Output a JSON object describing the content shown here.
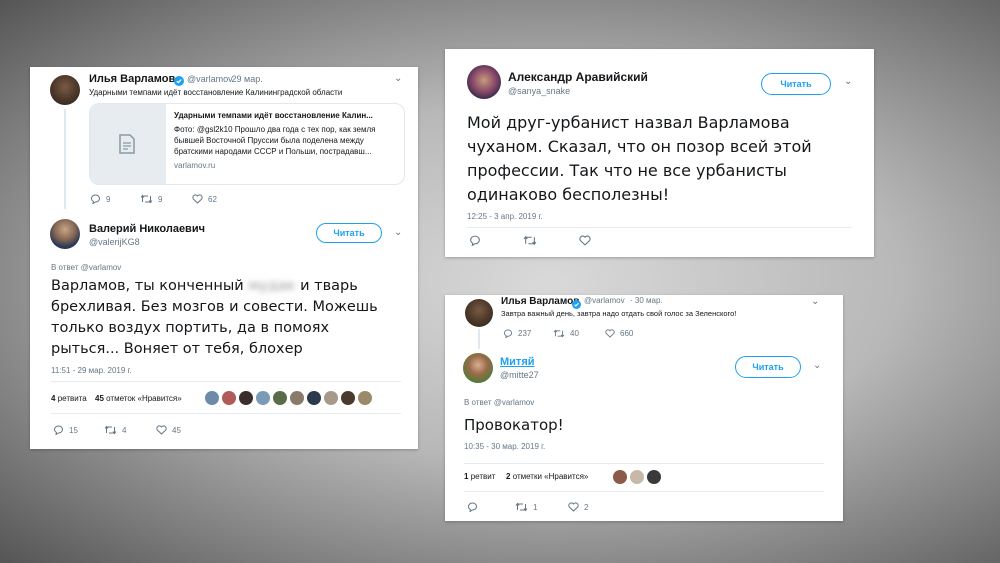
{
  "card1": {
    "author": "Илья Варламов",
    "handle": "@varlamov",
    "date": "· 29 мар.",
    "text": "Ударными темпами идёт восстановление Калининградской области",
    "link_title": "Ударными темпами идёт восстановление Калин...",
    "link_desc_1": "Фото: @gsl2k10 Прошло два года с тех пор, как земля",
    "link_desc_2": "бывшей Восточной Пруссии была поделена между",
    "link_desc_3": "братскими народами СССР и Польши, пострадавш...",
    "link_domain": "varlamov.ru",
    "replies": "9",
    "retweets": "9",
    "likes": "62",
    "reply_author": "Валерий Николаевич",
    "reply_handle": "@valerijKG8",
    "follow": "Читать",
    "in_reply_to": "В ответ @varlamov",
    "reply_line_1a": "Варламов, ты конченный",
    "reply_blurred": "мудак",
    "reply_line_1b": "и тварь",
    "reply_line_2": "брехливая. Без мозгов и совести. Можешь",
    "reply_line_3": "только воздух портить, да в помоях",
    "reply_line_4": "рыться... Воняет от тебя, блохер",
    "reply_time": "11:51 - 29 мар. 2019 г.",
    "retweet_count": "4",
    "retweet_label": "ретвита",
    "like_count": "45",
    "like_label": "отметок «Нравится»",
    "r_replies": "15",
    "r_retweets": "4",
    "r_likes": "45"
  },
  "card2": {
    "author": "Александр Аравийский",
    "handle": "@sanya_snake",
    "follow": "Читать",
    "line_1": "Мой друг-урбанист назвал Варламова",
    "line_2": "чуханом. Сказал, что он позор всей этой",
    "line_3": "профессии. Так что не все урбанисты",
    "line_4": "одинаково бесполезны!",
    "time": "12:25 - 3 апр. 2019 г."
  },
  "card3": {
    "author": "Илья Варламов",
    "handle": "@varlamov",
    "date": "· 30 мар.",
    "text": "Завтра важный день, завтра надо отдать свой голос за Зеленского!",
    "replies": "237",
    "retweets": "40",
    "likes": "660",
    "reply_author": "Митяй",
    "reply_handle": "@mitte27",
    "follow": "Читать",
    "in_reply_to": "В ответ @varlamov",
    "reply_text": "Провокатор!",
    "reply_time": "10:35 - 30 мар. 2019 г.",
    "retweet_count": "1",
    "retweet_label": "ретвит",
    "like_count": "2",
    "like_label": "отметки «Нравится»",
    "r_replies": "",
    "r_retweets": "1",
    "r_likes": "2"
  },
  "colors": {
    "accent": "#1da1f2",
    "verified": "#1da1f2",
    "muted": "#657786"
  },
  "icons": [
    "reply-icon",
    "retweet-icon",
    "like-icon",
    "verified-icon",
    "chevron-down-icon",
    "document-icon"
  ]
}
